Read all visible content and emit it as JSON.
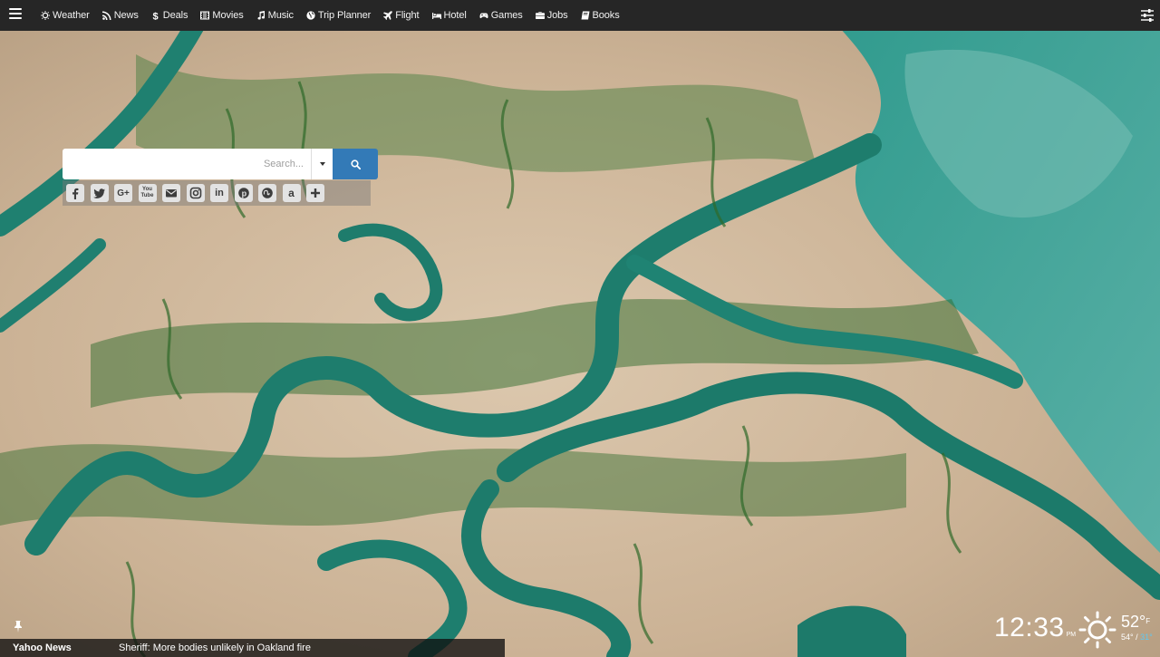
{
  "nav": {
    "items": [
      {
        "label": "Weather",
        "icon": "sun-icon"
      },
      {
        "label": "News",
        "icon": "rss-icon"
      },
      {
        "label": "Deals",
        "icon": "dollar-icon"
      },
      {
        "label": "Movies",
        "icon": "film-icon"
      },
      {
        "label": "Music",
        "icon": "music-note-icon"
      },
      {
        "label": "Trip Planner",
        "icon": "globe-icon"
      },
      {
        "label": "Flight",
        "icon": "plane-icon"
      },
      {
        "label": "Hotel",
        "icon": "bed-icon"
      },
      {
        "label": "Games",
        "icon": "gamepad-icon"
      },
      {
        "label": "Jobs",
        "icon": "briefcase-icon"
      },
      {
        "label": "Books",
        "icon": "book-icon"
      }
    ]
  },
  "search": {
    "placeholder": "Search...",
    "value": ""
  },
  "social": [
    "facebook-icon",
    "twitter-icon",
    "google-plus-icon",
    "youtube-icon",
    "email-icon",
    "instagram-icon",
    "linkedin-icon",
    "pinterest-icon",
    "stumbleupon-icon",
    "amazon-icon",
    "add-icon"
  ],
  "news": {
    "source": "Yahoo News",
    "headline": "Sheriff: More bodies unlikely in Oakland fire"
  },
  "clock": {
    "time": "12:33",
    "ampm": "PM"
  },
  "weather": {
    "current": "52°",
    "unit": "F",
    "high": "54°",
    "separator": " / ",
    "low": "31°"
  },
  "colors": {
    "topbar": "#262626",
    "search_button": "#337ab7",
    "river": "#1f7f6e",
    "sand": "#d2bca2"
  }
}
